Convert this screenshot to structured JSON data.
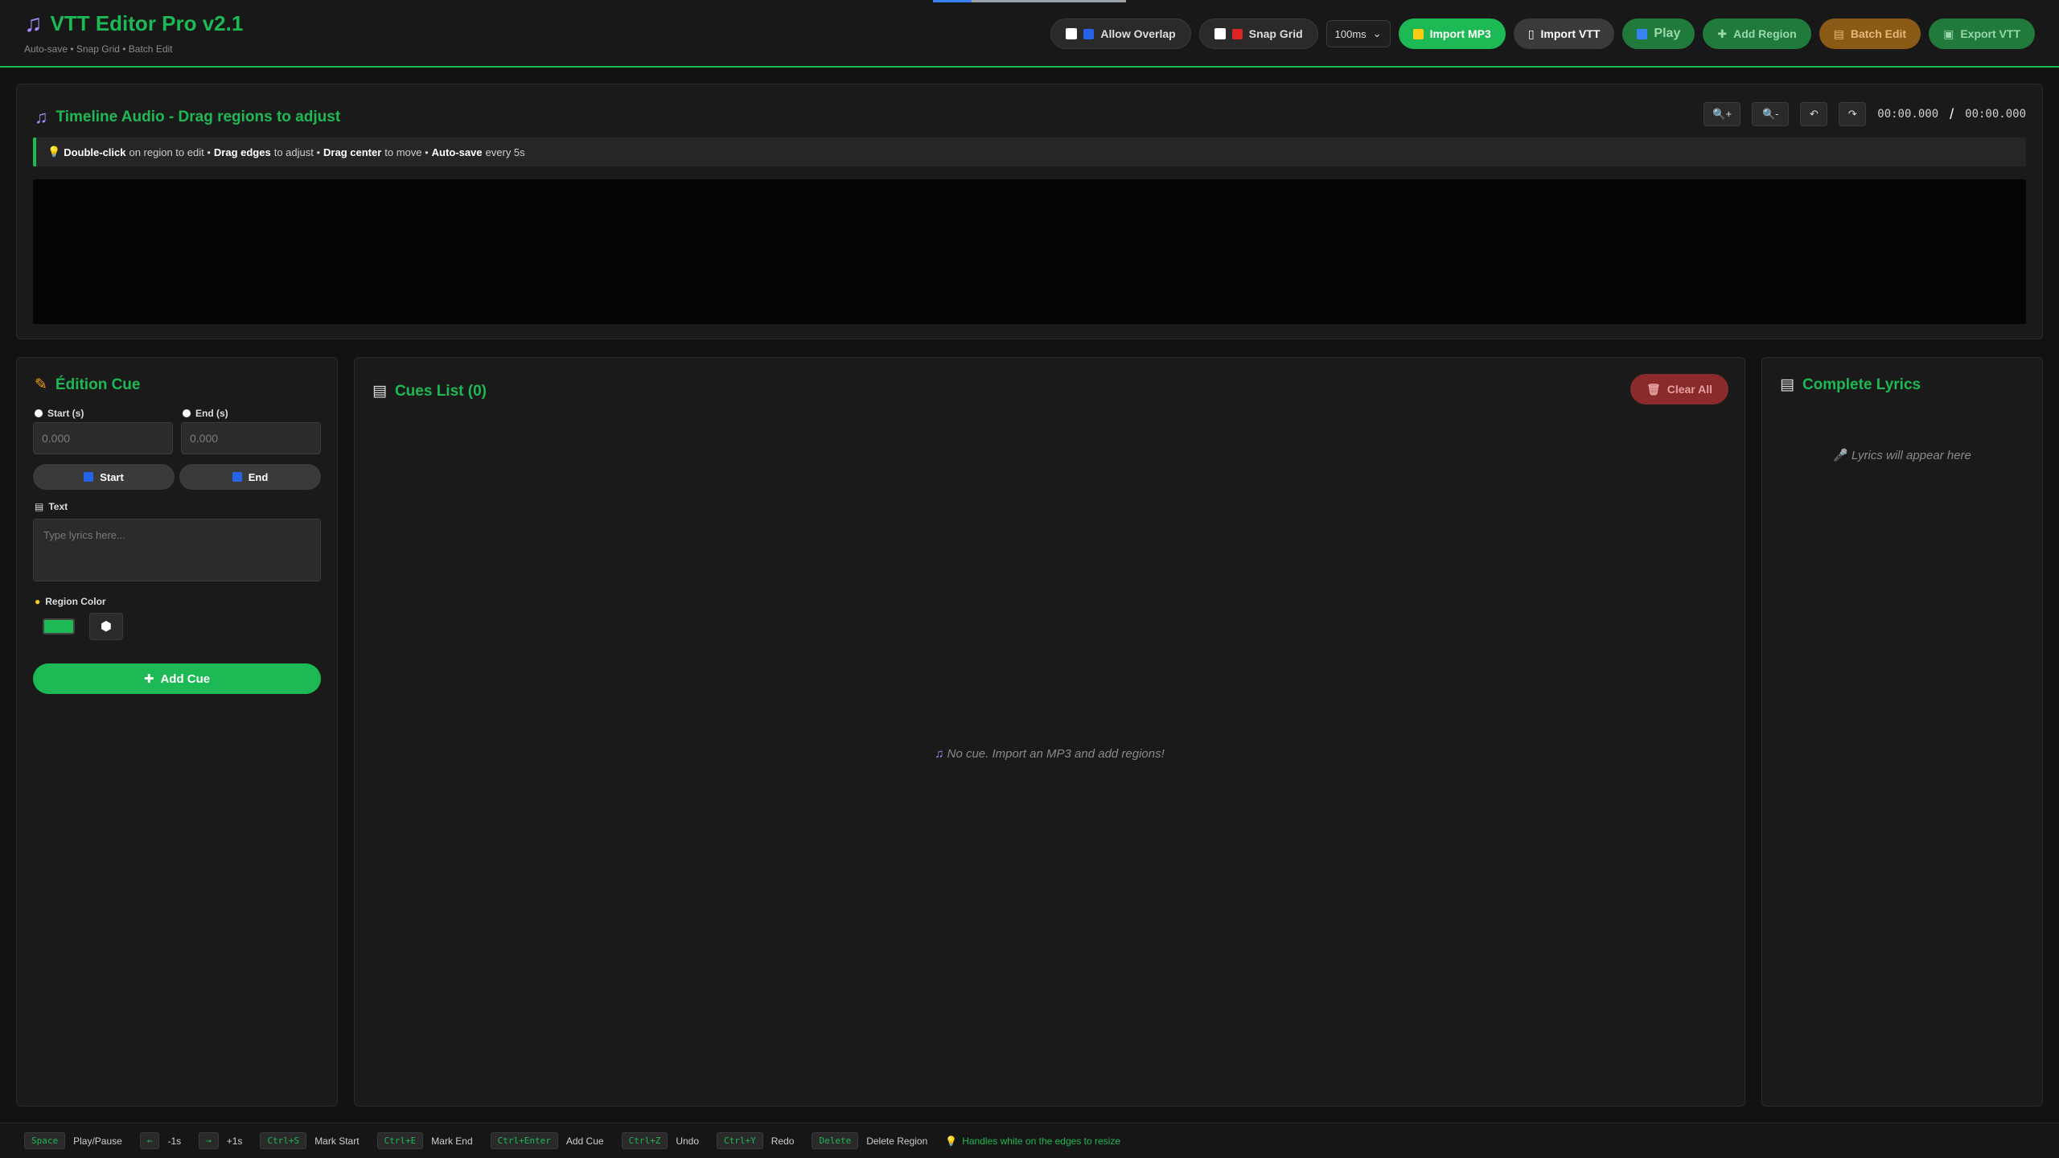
{
  "header": {
    "title": "VTT Editor Pro v2.1",
    "subtitle": "Auto-save • Snap Grid • Batch Edit",
    "allow_overlap": "Allow Overlap",
    "snap_grid": "Snap Grid",
    "grid_value": "100ms",
    "import_mp3": "Import MP3",
    "import_vtt": "Import VTT",
    "play": "Play",
    "add_region": "Add Region",
    "batch_edit": "Batch Edit",
    "export_vtt": "Export VTT"
  },
  "timeline": {
    "title": "Timeline Audio - Drag regions to adjust",
    "zoom_in": "🔍+",
    "zoom_out": "🔍-",
    "undo": "↶",
    "redo": "↷",
    "current_time": "00:00.000",
    "separator": "/",
    "total_time": "00:00.000",
    "tip": {
      "t1": "Double-click",
      "t2": "on region to edit •",
      "t3": "Drag edges",
      "t4": "to adjust •",
      "t5": "Drag center",
      "t6": "to move •",
      "t7": "Auto-save",
      "t8": "every 5s"
    }
  },
  "edit": {
    "title": "Édition Cue",
    "start_label": "Start (s)",
    "end_label": "End (s)",
    "start_placeholder": "0.000",
    "end_placeholder": "0.000",
    "mark_start": "Start",
    "mark_end": "End",
    "text_label": "Text",
    "text_placeholder": "Type lyrics here...",
    "color_label": "Region Color",
    "color_value": "#1db954",
    "add_cue": "Add Cue"
  },
  "cues": {
    "title": "Cues List (0)",
    "clear_all": "Clear All",
    "empty": "No cue. Import an MP3 and add regions!"
  },
  "lyrics": {
    "title": "Complete Lyrics",
    "empty": "Lyrics will appear here"
  },
  "footer": {
    "shortcuts": [
      {
        "key": "Space",
        "desc": "Play/Pause"
      },
      {
        "key": "←",
        "desc": "-1s"
      },
      {
        "key": "→",
        "desc": "+1s"
      },
      {
        "key": "Ctrl+S",
        "desc": "Mark Start"
      },
      {
        "key": "Ctrl+E",
        "desc": "Mark End"
      },
      {
        "key": "Ctrl+Enter",
        "desc": "Add Cue"
      },
      {
        "key": "Ctrl+Z",
        "desc": "Undo"
      },
      {
        "key": "Ctrl+Y",
        "desc": "Redo"
      },
      {
        "key": "Delete",
        "desc": "Delete Region"
      }
    ],
    "tip": "Handles white on the edges to resize"
  },
  "colors": {
    "accent": "#1db954",
    "danger": "#8a2a2a",
    "warning": "#8a5a16"
  }
}
